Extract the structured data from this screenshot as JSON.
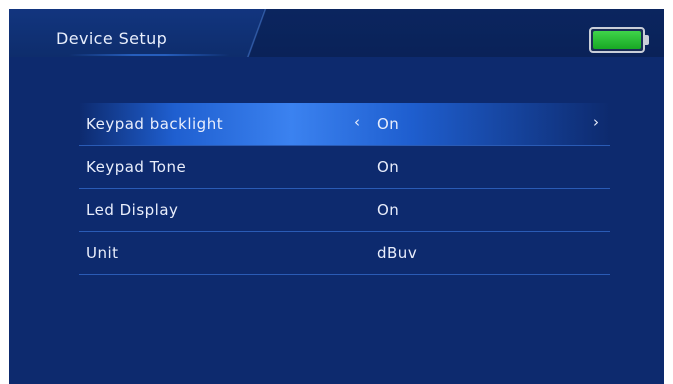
{
  "header": {
    "title": "Device Setup",
    "battery_icon": "battery-full-icon",
    "battery_color": "#2ecc40"
  },
  "menu": {
    "items": [
      {
        "label": "Keypad backlight",
        "value": "On",
        "selected": true
      },
      {
        "label": "Keypad Tone",
        "value": "On",
        "selected": false
      },
      {
        "label": "Led Display",
        "value": "On",
        "selected": false
      },
      {
        "label": "Unit",
        "value": "dBuv",
        "selected": false
      }
    ],
    "arrow_left": "‹",
    "arrow_right": "›"
  },
  "colors": {
    "background": "#0d2a6e",
    "highlight": "#3b82f0",
    "text": "#e9eefc"
  }
}
